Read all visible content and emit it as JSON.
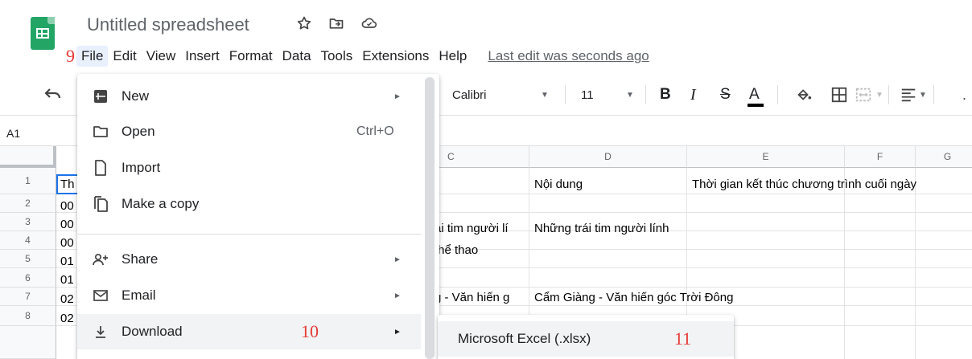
{
  "doc": {
    "title": "Untitled spreadsheet",
    "last_edit": "Last edit was seconds ago"
  },
  "annotations": {
    "step1": "9",
    "step2": "10",
    "step3": "11"
  },
  "menubar": [
    {
      "label": "File"
    },
    {
      "label": "Edit"
    },
    {
      "label": "View"
    },
    {
      "label": "Insert"
    },
    {
      "label": "Format"
    },
    {
      "label": "Data"
    },
    {
      "label": "Tools"
    },
    {
      "label": "Extensions"
    },
    {
      "label": "Help"
    }
  ],
  "toolbar": {
    "font": "Calibri",
    "font_size": "11",
    "bold": "B",
    "italic": "I",
    "strike": "S",
    "text_color": "A"
  },
  "namebox": "A1",
  "columns": [
    "C",
    "D",
    "E",
    "F",
    "G"
  ],
  "rows": [
    "1",
    "2",
    "3",
    "4",
    "5",
    "6",
    "7",
    "8"
  ],
  "cells": {
    "a1": "Th",
    "a2": "00",
    "a3": "00",
    "a4": "00",
    "a5": "01",
    "a6": "01",
    "a7": "02",
    "a8": "02",
    "c3": "ái tim người lí",
    "c4": "thể thao",
    "c6": "g - Văn hiến g",
    "d1": "Nội dung",
    "d3": "Những trái tim người lính",
    "d6": "Cẩm Giàng - Văn hiến góc Trời Đông",
    "e1": "Thời gian kết thúc chương trình cuối ngày"
  },
  "file_menu": {
    "new": "New",
    "open": "Open",
    "open_shortcut": "Ctrl+O",
    "import": "Import",
    "copy": "Make a copy",
    "share": "Share",
    "email": "Email",
    "download": "Download"
  },
  "download_menu": {
    "xlsx": "Microsoft Excel (.xlsx)"
  },
  "colors": {
    "brand": "#23a566",
    "selection": "#1a73e8",
    "marker": "#e53935"
  }
}
